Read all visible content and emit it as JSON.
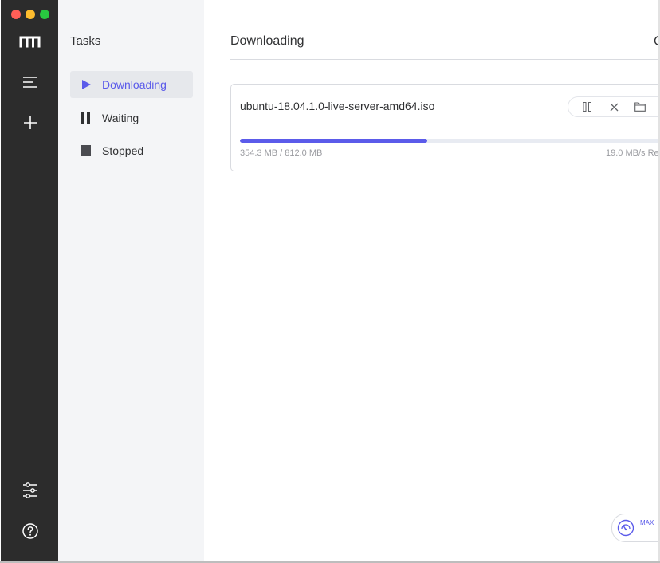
{
  "sidebar": {
    "icons": [
      "logo-icon",
      "menu-icon",
      "add-icon",
      "settings-sliders-icon",
      "help-icon"
    ]
  },
  "subnav": {
    "title": "Tasks",
    "items": [
      {
        "label": "Downloading",
        "icon": "play-icon",
        "active": true
      },
      {
        "label": "Waiting",
        "icon": "pause-icon",
        "active": false
      },
      {
        "label": "Stopped",
        "icon": "stop-icon",
        "active": false
      }
    ]
  },
  "main": {
    "title": "Downloading",
    "task": {
      "filename": "ubuntu-18.04.1.0-live-server-amd64.iso",
      "progress_fraction": 0.436,
      "size_text": "354.3 MB / 812.0 MB",
      "speed_text": "19.0 MB/s Re"
    },
    "speed_limit_label": "MAX"
  },
  "colors": {
    "accent": "#5b5bea",
    "rail_bg": "#2c2c2c",
    "subnav_bg": "#f4f5f7"
  }
}
